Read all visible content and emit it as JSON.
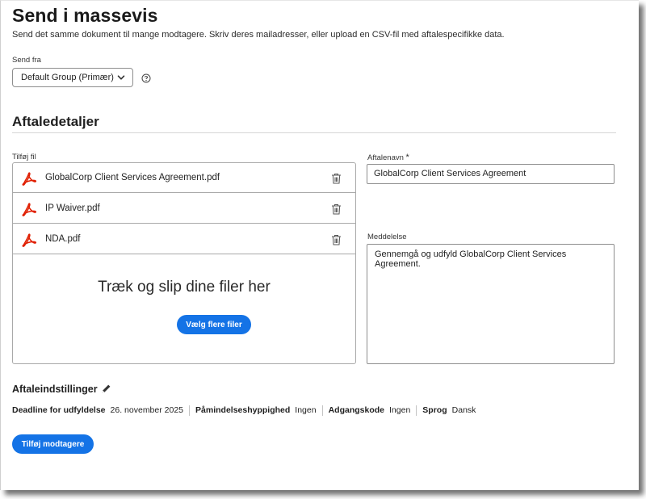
{
  "page": {
    "title": "Send i massevis",
    "subtitle": "Send det samme dokument til mange modtagere. Skriv deres mailadresser, eller upload en CSV-fil med aftalespecifikke data."
  },
  "send_from": {
    "label": "Send fra",
    "selected": "Default Group (Primær)",
    "chevron_icon": "chevron-down-icon",
    "help_icon": "help-circle-icon"
  },
  "agreement_details": {
    "title": "Aftaledetaljer",
    "add_file_label": "Tilføj fil",
    "files": [
      {
        "name": "GlobalCorp Client Services Agreement.pdf",
        "icon": "pdf-icon"
      },
      {
        "name": "IP Waiver.pdf",
        "icon": "pdf-icon"
      },
      {
        "name": "NDA.pdf",
        "icon": "pdf-icon"
      }
    ],
    "dropzone_text": "Træk og slip dine filer her",
    "choose_more_button": "Vælg flere filer",
    "agreement_name_label": "Aftalenavn",
    "required_marker": "*",
    "agreement_name_value": "GlobalCorp Client Services Agreement",
    "message_label": "Meddelelse",
    "message_value": "Gennemgå og udfyld GlobalCorp Client Services Agreement."
  },
  "agreement_settings": {
    "title": "Aftaleindstillinger",
    "edit_icon": "pencil-icon",
    "items": [
      {
        "key": "Deadline for udfyldelse",
        "value": "26. november 2025"
      },
      {
        "key": "Påmindelseshyppighed",
        "value": "Ingen"
      },
      {
        "key": "Adgangskode",
        "value": "Ingen"
      },
      {
        "key": "Sprog",
        "value": "Dansk"
      }
    ]
  },
  "actions": {
    "add_recipients_button": "Tilføj modtagere"
  },
  "colors": {
    "accent": "#1473e6",
    "pdf_red": "#e01e00"
  }
}
